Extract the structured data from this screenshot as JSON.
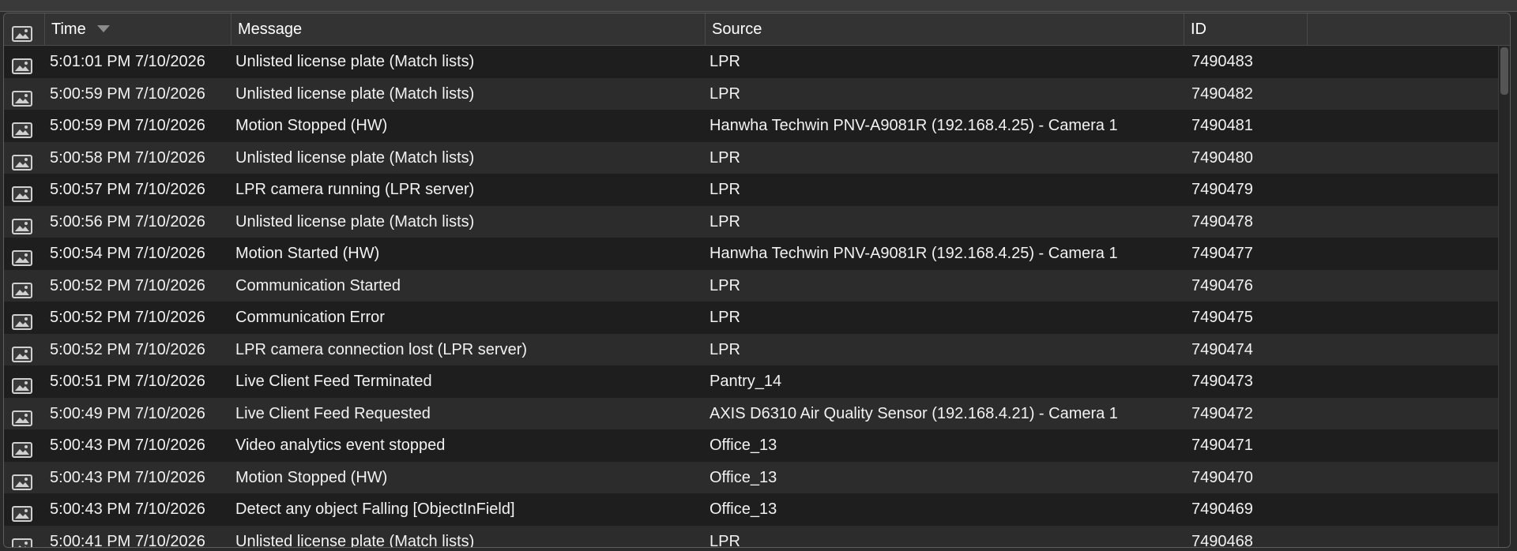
{
  "columns": {
    "icon": "",
    "time": "Time",
    "message": "Message",
    "source": "Source",
    "id": "ID"
  },
  "rows": [
    {
      "time": "5:01:01 PM 7/10/2026",
      "message": "Unlisted license plate (Match lists)",
      "source": "LPR",
      "id": "7490483"
    },
    {
      "time": "5:00:59 PM 7/10/2026",
      "message": "Unlisted license plate (Match lists)",
      "source": "LPR",
      "id": "7490482"
    },
    {
      "time": "5:00:59 PM 7/10/2026",
      "message": "Motion Stopped (HW)",
      "source": "Hanwha Techwin PNV-A9081R (192.168.4.25) - Camera 1",
      "id": "7490481"
    },
    {
      "time": "5:00:58 PM 7/10/2026",
      "message": "Unlisted license plate (Match lists)",
      "source": "LPR",
      "id": "7490480"
    },
    {
      "time": "5:00:57 PM 7/10/2026",
      "message": "LPR camera running (LPR server)",
      "source": "LPR",
      "id": "7490479"
    },
    {
      "time": "5:00:56 PM 7/10/2026",
      "message": "Unlisted license plate (Match lists)",
      "source": "LPR",
      "id": "7490478"
    },
    {
      "time": "5:00:54 PM 7/10/2026",
      "message": "Motion Started (HW)",
      "source": "Hanwha Techwin PNV-A9081R (192.168.4.25) - Camera 1",
      "id": "7490477"
    },
    {
      "time": "5:00:52 PM 7/10/2026",
      "message": "Communication Started",
      "source": "LPR",
      "id": "7490476"
    },
    {
      "time": "5:00:52 PM 7/10/2026",
      "message": "Communication Error",
      "source": "LPR",
      "id": "7490475"
    },
    {
      "time": "5:00:52 PM 7/10/2026",
      "message": "LPR camera connection lost (LPR server)",
      "source": "LPR",
      "id": "7490474"
    },
    {
      "time": "5:00:51 PM 7/10/2026",
      "message": "Live Client Feed Terminated",
      "source": "Pantry_14",
      "id": "7490473"
    },
    {
      "time": "5:00:49 PM 7/10/2026",
      "message": "Live Client Feed Requested",
      "source": "AXIS D6310 Air Quality Sensor (192.168.4.21) - Camera 1",
      "id": "7490472"
    },
    {
      "time": "5:00:43 PM 7/10/2026",
      "message": "Video analytics event stopped",
      "source": "Office_13",
      "id": "7490471"
    },
    {
      "time": "5:00:43 PM 7/10/2026",
      "message": "Motion Stopped (HW)",
      "source": "Office_13",
      "id": "7490470"
    },
    {
      "time": "5:00:43 PM 7/10/2026",
      "message": "Detect any object Falling [ObjectInField]",
      "source": "Office_13",
      "id": "7490469"
    },
    {
      "time": "5:00:41 PM 7/10/2026",
      "message": "Unlisted license plate (Match lists)",
      "source": "LPR",
      "id": "7490468"
    }
  ],
  "icons": {
    "header": "image-icon",
    "row": "image-icon",
    "sort": "sort-descending-icon"
  },
  "colors": {
    "background": "#1f1f1f",
    "row_alt": "#2c2c2c",
    "header": "#333333",
    "text": "#f2f2f2"
  }
}
